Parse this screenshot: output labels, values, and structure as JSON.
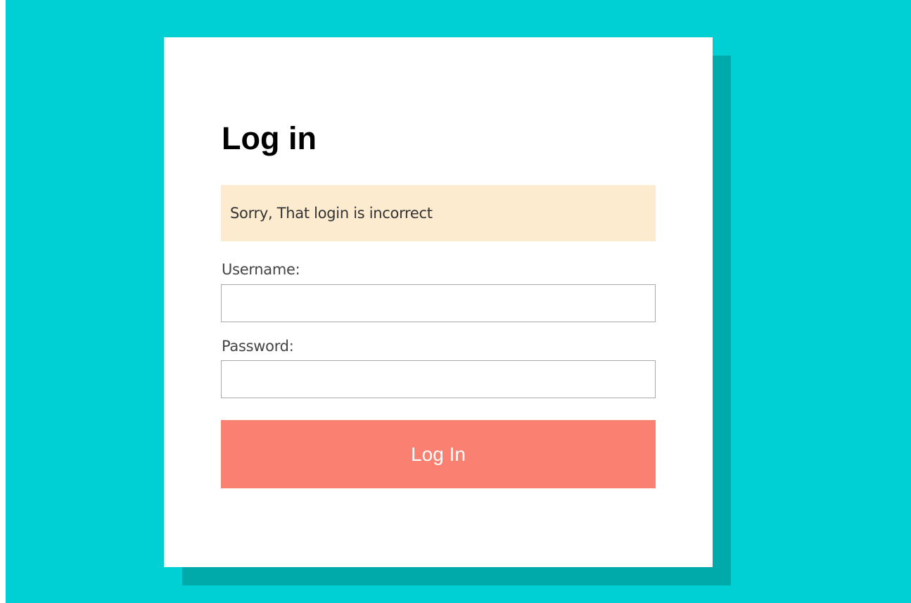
{
  "colors": {
    "background": "#00cfd4",
    "card_shadow": "#00a9aa",
    "card": "#ffffff",
    "alert_bg": "#fdebd0",
    "button_bg": "#fa8072",
    "button_text": "#ffffff"
  },
  "login": {
    "title": "Log in",
    "alert_message": "Sorry, That login is incorrect",
    "username_label": "Username:",
    "username_value": "",
    "password_label": "Password:",
    "password_value": "",
    "submit_label": "Log In"
  }
}
